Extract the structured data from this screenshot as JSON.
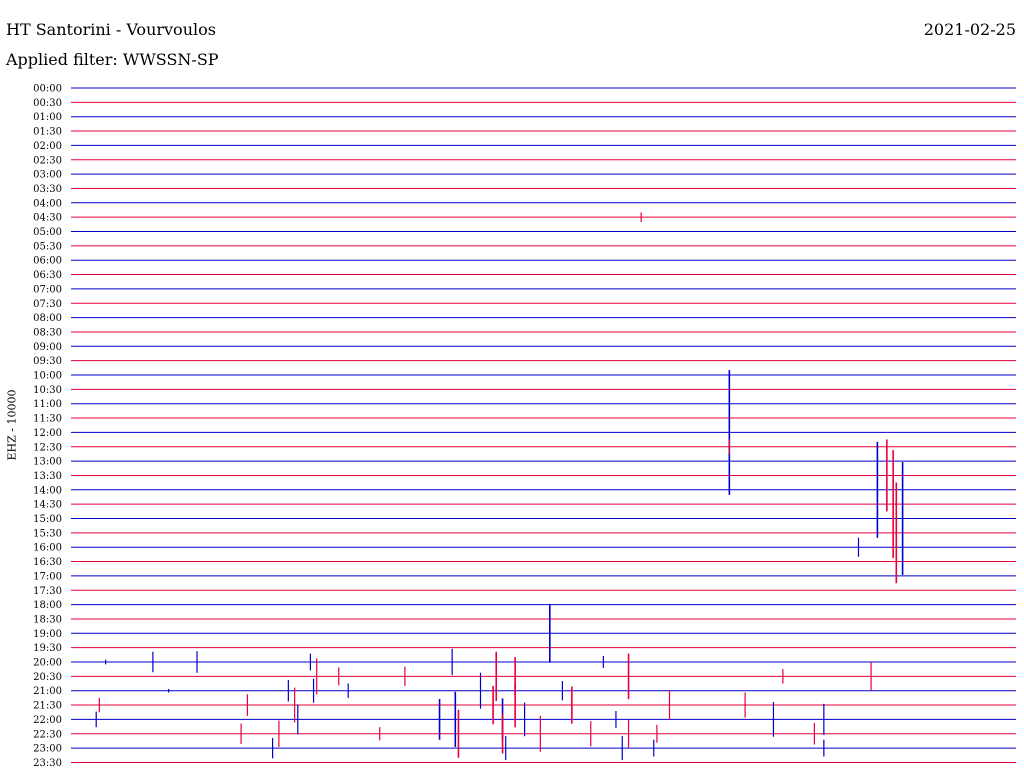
{
  "header": {
    "station": "HT Santorini - Vourvoulos",
    "filter": "Applied filter: WWSSN-SP",
    "date": "2021-02-25"
  },
  "chart_data": {
    "type": "line",
    "title": "HT Santorini - Vourvoulos",
    "subtitle": "Applied filter: WWSSN-SP",
    "ylabel": "EHZ - 10000",
    "rows": [
      "00:00",
      "00:30",
      "01:00",
      "01:30",
      "02:00",
      "02:30",
      "03:00",
      "03:30",
      "04:00",
      "04:30",
      "05:00",
      "05:30",
      "06:00",
      "06:30",
      "07:00",
      "07:30",
      "08:00",
      "08:30",
      "09:00",
      "09:30",
      "10:00",
      "10:30",
      "11:00",
      "11:30",
      "12:00",
      "12:30",
      "13:00",
      "13:30",
      "14:00",
      "14:30",
      "15:00",
      "15:30",
      "16:00",
      "16:30",
      "17:00",
      "17:30",
      "18:00",
      "18:30",
      "19:00",
      "19:30",
      "20:00",
      "20:30",
      "21:00",
      "21:30",
      "22:00",
      "22:30",
      "23:00",
      "23:30"
    ],
    "series_colors": [
      "#0000cc",
      "#e8003a"
    ],
    "x_range_minutes": [
      0,
      30
    ],
    "events": [
      {
        "row": "04:30",
        "t": 18.1,
        "amp": 0.8
      },
      {
        "row": "12:00",
        "t": 20.9,
        "amp": 10.4
      },
      {
        "row": "12:30",
        "t": 20.9,
        "amp": 1.2
      },
      {
        "row": "13:30",
        "t": 25.9,
        "amp": 6.0
      },
      {
        "row": "14:00",
        "t": 25.6,
        "amp": 8.0
      },
      {
        "row": "14:30",
        "t": 26.1,
        "amp": 9.0
      },
      {
        "row": "15:00",
        "t": 26.4,
        "amp": 9.4
      },
      {
        "row": "15:30",
        "t": 26.2,
        "amp": 8.4
      },
      {
        "row": "16:00",
        "t": 25.0,
        "amp": 1.6
      },
      {
        "row": "19:00",
        "t": 15.2,
        "amp": 4.9
      },
      {
        "row": "20:00",
        "t": 1.1,
        "amp": 0.4
      },
      {
        "row": "20:00",
        "t": 2.6,
        "amp": 1.7
      },
      {
        "row": "20:00",
        "t": 4.0,
        "amp": 1.8
      },
      {
        "row": "20:00",
        "t": 7.6,
        "amp": 1.4
      },
      {
        "row": "20:00",
        "t": 12.1,
        "amp": 2.2
      },
      {
        "row": "20:00",
        "t": 16.9,
        "amp": 1.0
      },
      {
        "row": "20:30",
        "t": 7.8,
        "amp": 3.0
      },
      {
        "row": "20:30",
        "t": 8.5,
        "amp": 1.5
      },
      {
        "row": "20:30",
        "t": 10.6,
        "amp": 1.6
      },
      {
        "row": "20:30",
        "t": 13.5,
        "amp": 4.1
      },
      {
        "row": "20:30",
        "t": 14.1,
        "amp": 3.2
      },
      {
        "row": "20:30",
        "t": 17.7,
        "amp": 3.8
      },
      {
        "row": "20:30",
        "t": 22.6,
        "amp": 1.2
      },
      {
        "row": "20:30",
        "t": 25.4,
        "amp": 2.4
      },
      {
        "row": "21:00",
        "t": 3.1,
        "amp": 0.3
      },
      {
        "row": "21:00",
        "t": 6.9,
        "amp": 1.8
      },
      {
        "row": "21:00",
        "t": 7.7,
        "amp": 2.0
      },
      {
        "row": "21:00",
        "t": 8.8,
        "amp": 1.2
      },
      {
        "row": "21:00",
        "t": 13.0,
        "amp": 3.0
      },
      {
        "row": "21:00",
        "t": 15.6,
        "amp": 1.6
      },
      {
        "row": "21:30",
        "t": 0.9,
        "amp": 1.2
      },
      {
        "row": "21:30",
        "t": 5.6,
        "amp": 1.8
      },
      {
        "row": "21:30",
        "t": 7.1,
        "amp": 2.9
      },
      {
        "row": "21:30",
        "t": 13.4,
        "amp": 3.2
      },
      {
        "row": "21:30",
        "t": 14.1,
        "amp": 3.7
      },
      {
        "row": "21:30",
        "t": 15.9,
        "amp": 3.1
      },
      {
        "row": "21:30",
        "t": 19.0,
        "amp": 2.4
      },
      {
        "row": "21:30",
        "t": 21.4,
        "amp": 2.1
      },
      {
        "row": "22:00",
        "t": 0.8,
        "amp": 1.3
      },
      {
        "row": "22:00",
        "t": 7.2,
        "amp": 2.5
      },
      {
        "row": "22:00",
        "t": 11.7,
        "amp": 3.4
      },
      {
        "row": "22:00",
        "t": 12.2,
        "amp": 4.6
      },
      {
        "row": "22:00",
        "t": 13.7,
        "amp": 3.5
      },
      {
        "row": "22:00",
        "t": 14.4,
        "amp": 2.8
      },
      {
        "row": "22:00",
        "t": 17.3,
        "amp": 1.4
      },
      {
        "row": "22:00",
        "t": 22.3,
        "amp": 2.9
      },
      {
        "row": "22:00",
        "t": 23.9,
        "amp": 2.6
      },
      {
        "row": "22:30",
        "t": 5.4,
        "amp": 1.7
      },
      {
        "row": "22:30",
        "t": 6.6,
        "amp": 2.2
      },
      {
        "row": "22:30",
        "t": 9.8,
        "amp": 1.1
      },
      {
        "row": "22:30",
        "t": 12.3,
        "amp": 4.0
      },
      {
        "row": "22:30",
        "t": 13.7,
        "amp": 3.3
      },
      {
        "row": "22:30",
        "t": 14.9,
        "amp": 3.0
      },
      {
        "row": "22:30",
        "t": 16.5,
        "amp": 2.1
      },
      {
        "row": "22:30",
        "t": 17.7,
        "amp": 2.3
      },
      {
        "row": "22:30",
        "t": 18.6,
        "amp": 1.5
      },
      {
        "row": "22:30",
        "t": 23.6,
        "amp": 1.8
      },
      {
        "row": "23:00",
        "t": 6.4,
        "amp": 1.7
      },
      {
        "row": "23:00",
        "t": 13.8,
        "amp": 2.0
      },
      {
        "row": "23:00",
        "t": 17.5,
        "amp": 2.0
      },
      {
        "row": "23:00",
        "t": 18.5,
        "amp": 1.4
      },
      {
        "row": "23:00",
        "t": 23.9,
        "amp": 1.4
      }
    ]
  }
}
